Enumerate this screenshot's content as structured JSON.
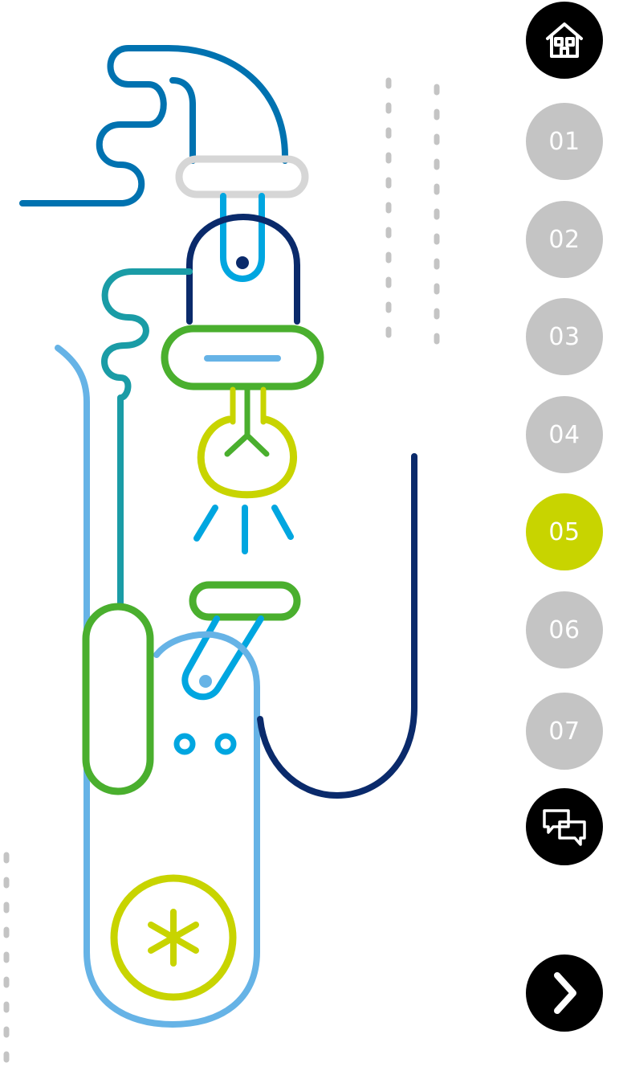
{
  "nav": {
    "home": {
      "icon": "home-icon"
    },
    "sections": [
      {
        "label": "01",
        "state": "inactive"
      },
      {
        "label": "02",
        "state": "inactive"
      },
      {
        "label": "03",
        "state": "inactive"
      },
      {
        "label": "04",
        "state": "inactive"
      },
      {
        "label": "05",
        "state": "active"
      },
      {
        "label": "06",
        "state": "inactive"
      },
      {
        "label": "07",
        "state": "inactive"
      }
    ],
    "contact": {
      "icon": "chat-bubbles-icon"
    },
    "next": {
      "icon": "chevron-right-icon"
    }
  },
  "colors": {
    "active": "#c8d400",
    "inactive": "#c4c4c4",
    "icon_button": "#000000",
    "dark_blue": "#0a2a6b",
    "mid_blue": "#0072b0",
    "light_blue": "#66b3e6",
    "cyan": "#00a6e0",
    "teal": "#1a9ca6",
    "green": "#4aaf2e",
    "lime": "#c8d400",
    "light_grey": "#d6d6d6"
  }
}
